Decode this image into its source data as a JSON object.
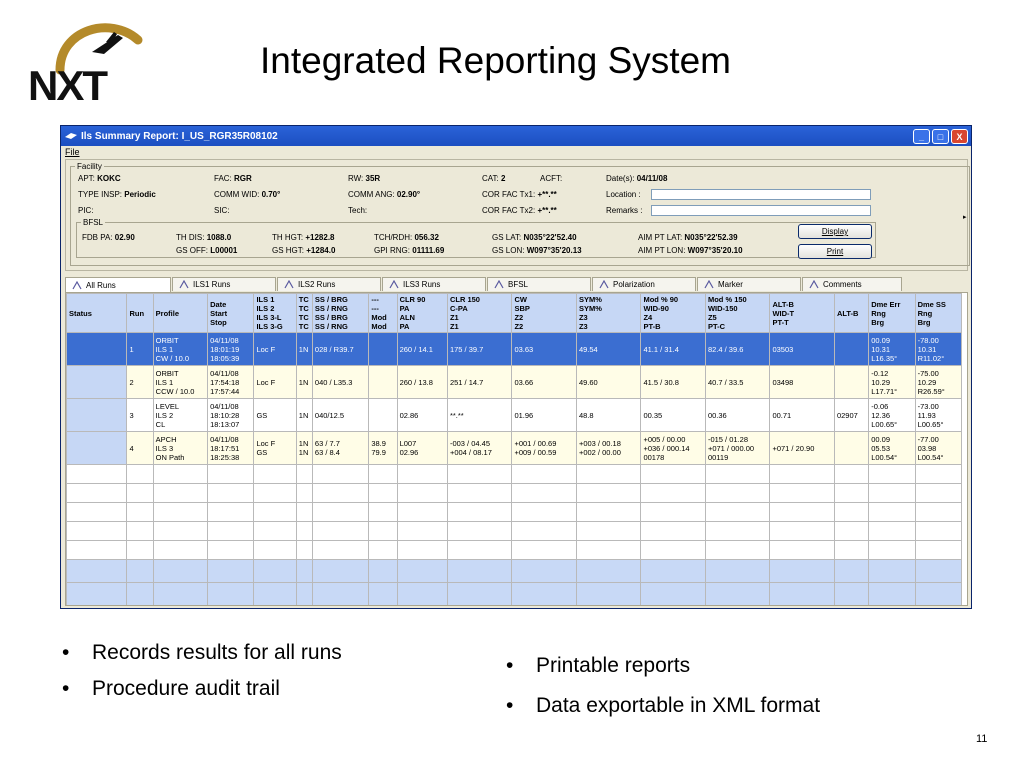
{
  "slide": {
    "logo_text": "NXT",
    "title": "Integrated Reporting System",
    "page_number": "11",
    "bullets_left": [
      "Records results for all runs",
      "Procedure audit trail"
    ],
    "bullets_right": [
      "Printable reports",
      "Data exportable in XML format"
    ]
  },
  "window": {
    "title": "Ils Summary Report: I_US_RGR35R08102",
    "menu": "File",
    "buttons": {
      "minimize": "_",
      "maximize": "□",
      "close": "X"
    }
  },
  "facility": {
    "legend": "Facility",
    "apt_label": "APT:",
    "apt": "KOKC",
    "fac_label": "FAC:",
    "fac": "RGR",
    "rw_label": "RW:",
    "rw": "35R",
    "cat_label": "CAT:",
    "cat": "2",
    "acft_label": "ACFT:",
    "dates_label": "Date(s):",
    "dates": "04/11/08",
    "type_insp_label": "TYPE INSP:",
    "type_insp": "Periodic",
    "comm_wid_label": "COMM WID:",
    "comm_wid": "0.70°",
    "comm_ang_label": "COMM ANG:",
    "comm_ang": "02.90°",
    "cor_fac_tx1_label": "COR FAC Tx1:",
    "cor_fac_tx1": "+**.**",
    "location_label": "Location :",
    "pic_label": "PIC:",
    "sic_label": "SIC:",
    "tech_label": "Tech:",
    "cor_fac_tx2_label": "COR FAC Tx2:",
    "cor_fac_tx2": "+**.**",
    "remarks_label": "Remarks :"
  },
  "bfsl": {
    "legend": "BFSL",
    "fdb_pa_label": "FDB PA:",
    "fdb_pa": "02.90",
    "th_dis_label": "TH DIS:",
    "th_dis": "1088.0",
    "th_hgt_label": "TH HGT:",
    "th_hgt": "+1282.8",
    "tch_rdh_label": "TCH/RDH:",
    "tch_rdh": "056.32",
    "gs_lat_label": "GS LAT:",
    "gs_lat": "N035°22'52.40",
    "aim_pt_lat_label": "AIM PT LAT:",
    "aim_pt_lat": "N035°22'52.39",
    "gs_off_label": "GS OFF:",
    "gs_off": "L00001",
    "gs_hgt_label": "GS HGT:",
    "gs_hgt": "+1284.0",
    "gpi_rng_label": "GPI RNG:",
    "gpi_rng": "01111.69",
    "gs_lon_label": "GS LON:",
    "gs_lon": "W097°35'20.13",
    "aim_pt_lon_label": "AIM PT LON:",
    "aim_pt_lon": "W097°35'20.10"
  },
  "actions": {
    "display": "Display",
    "print": "Print"
  },
  "tabs": [
    "All Runs",
    "ILS1 Runs",
    "ILS2 Runs",
    "ILS3 Runs",
    "BFSL",
    "Polarization",
    "Marker",
    "Comments"
  ],
  "tab_icons": [
    "123-icon",
    "ils1-icon",
    "ils2-icon",
    "ils3-icon",
    "bfsl-icon",
    "polarization-icon",
    "marker-icon",
    "comments-icon"
  ],
  "grid": {
    "headers": [
      [
        "Status"
      ],
      [
        "Run"
      ],
      [
        "Profile"
      ],
      [
        "Date",
        "Start",
        "Stop"
      ],
      [
        "ILS 1",
        "ILS 2",
        "ILS 3-L",
        "ILS 3-G"
      ],
      [
        "TC",
        "TC",
        "TC",
        "TC"
      ],
      [
        "SS / BRG",
        "SS / RNG",
        "SS / BRG",
        "SS / RNG"
      ],
      [
        "---",
        "---",
        "Mod",
        "Mod"
      ],
      [
        "CLR 90",
        "PA",
        "ALN",
        "PA"
      ],
      [
        "CLR 150",
        "C-PA",
        "Z1",
        "Z1"
      ],
      [
        "CW",
        "SBP",
        "Z2",
        "Z2"
      ],
      [
        "SYM%",
        "SYM%",
        "Z3",
        "Z3"
      ],
      [
        "Mod % 90",
        "WID-90",
        "Z4",
        "PT-B"
      ],
      [
        "Mod % 150",
        "WID-150",
        "Z5",
        "PT-C"
      ],
      [
        "ALT-B",
        "WID-T",
        "",
        "PT-T"
      ],
      [
        "ALT-B"
      ],
      [
        "Dme Err",
        "Rng",
        "Brg"
      ],
      [
        "Dme SS",
        "Rng",
        "Brg"
      ]
    ],
    "rows": [
      {
        "style": "sel",
        "cells": [
          [
            ""
          ],
          [
            "1"
          ],
          [
            "ORBIT",
            "ILS 1",
            "CW / 10.0"
          ],
          [
            "04/11/08",
            "18:01:19",
            "18:05:39"
          ],
          [
            "Loc F"
          ],
          [
            "1N"
          ],
          [
            "028 / R39.7"
          ],
          [
            ""
          ],
          [
            "260 / 14.1"
          ],
          [
            "175 / 39.7"
          ],
          [
            "03.63"
          ],
          [
            "49.54"
          ],
          [
            "41.1 / 31.4"
          ],
          [
            "82.4 / 39.6"
          ],
          [
            "03503"
          ],
          [
            ""
          ],
          [
            "00.09",
            "10.31",
            "L16.35°"
          ],
          [
            "-78.00",
            "10.31",
            "R11.02°"
          ]
        ]
      },
      {
        "style": "yellow",
        "cells": [
          [
            ""
          ],
          [
            "2"
          ],
          [
            "ORBIT",
            "ILS 1",
            "CCW / 10.0"
          ],
          [
            "04/11/08",
            "17:54:18",
            "17:57:44"
          ],
          [
            "Loc F"
          ],
          [
            "1N"
          ],
          [
            "040 / L35.3"
          ],
          [
            ""
          ],
          [
            "260 / 13.8"
          ],
          [
            "251 / 14.7"
          ],
          [
            "03.66"
          ],
          [
            "49.60"
          ],
          [
            "41.5 / 30.8"
          ],
          [
            "40.7 / 33.5"
          ],
          [
            "03498"
          ],
          [
            ""
          ],
          [
            "-0.12",
            "10.29",
            "L17.71°"
          ],
          [
            "-75.00",
            "10.29",
            "R26.59°"
          ]
        ]
      },
      {
        "style": "white",
        "cells": [
          [
            ""
          ],
          [
            "3"
          ],
          [
            "LEVEL",
            "ILS 2",
            "CL"
          ],
          [
            "04/11/08",
            "18:10:28",
            "18:13:07"
          ],
          [
            "GS"
          ],
          [
            "1N"
          ],
          [
            "040/12.5"
          ],
          [
            ""
          ],
          [
            "02.86"
          ],
          [
            "**.**"
          ],
          [
            "01.96"
          ],
          [
            "48.8"
          ],
          [
            "00.35"
          ],
          [
            "00.36"
          ],
          [
            "00.71"
          ],
          [
            "02907"
          ],
          [
            "-0.06",
            "12.36",
            "L00.65°"
          ],
          [
            "-73.00",
            "11.93",
            "L00.65°"
          ]
        ]
      },
      {
        "style": "yellow",
        "cells": [
          [
            ""
          ],
          [
            "4"
          ],
          [
            "APCH",
            "ILS 3",
            "ON Path"
          ],
          [
            "04/11/08",
            "18:17:51",
            "18:25:38"
          ],
          [
            "Loc F",
            "GS"
          ],
          [
            "1N",
            "1N"
          ],
          [
            "63 / 7.7",
            "63 / 8.4"
          ],
          [
            "38.9",
            "79.9"
          ],
          [
            "L007",
            "02.96"
          ],
          [
            "-003 / 04.45",
            "+004 / 08.17"
          ],
          [
            "+001 / 00.69",
            "+009 / 00.59"
          ],
          [
            "+003 / 00.18",
            "+002 / 00.00"
          ],
          [
            "+005 / 00.00",
            "+036 / 000.14",
            "00178"
          ],
          [
            "-015 / 01.28",
            "+071 / 000.00",
            "00119"
          ],
          [
            "+071 / 20.90"
          ],
          [
            ""
          ],
          [
            "00.09",
            "05.53",
            "L00.54°"
          ],
          [
            "-77.00",
            "03.98",
            "L00.54°"
          ]
        ]
      }
    ]
  },
  "colors": {
    "titlebar": "#2a63d8",
    "selected_row": "#3b6ed1",
    "header": "#c6d7f5",
    "window_bg": "#ece9d8"
  }
}
